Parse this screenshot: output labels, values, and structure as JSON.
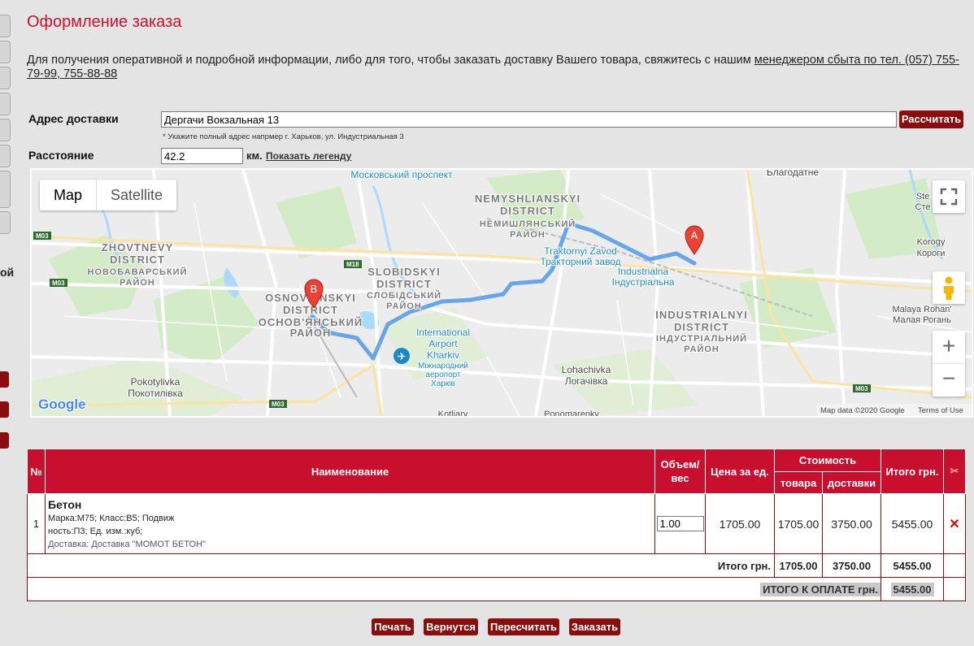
{
  "page": {
    "title": "Оформление заказа"
  },
  "info": {
    "text": "Для получения оперативной и подробной информации, либо для того, чтобы заказать доставку Вашего товара, свяжитесь с нашим ",
    "link": "менеджером сбыта по тел. (057) 755-79-99, 755-88-88"
  },
  "left_fragment": "ой",
  "delivery": {
    "label": "Адрес доставки",
    "value": "Дергачи Вокзальная 13",
    "calc_button": "Рассчитать",
    "hint": "* Укажите полный адрес напрмер г. Харьков, ул. Индустриальная 3"
  },
  "distance": {
    "label": "Расстояние",
    "value": "42.2",
    "unit": "км.",
    "legend_link": "Показать легенду"
  },
  "map": {
    "type_map": "Map",
    "type_satellite": "Satellite",
    "labels": {
      "moskovskyi": "Московський проспект",
      "blahodatne": "Благодатне",
      "nem_en": "NEMYSHLIANSKYI",
      "nem_en2": "DISTRICT",
      "nem_ua": "НЕМИШЛЯНСЬКИЙ",
      "nem_ua2": "РАЙОН",
      "zhov_en": "ZHOVTNEVY",
      "zhov_en2": "DISTRICT",
      "zhov_ua": "НОВОБАВАРСЬКИЙ",
      "zhov_ua2": "РАЙОН",
      "slob_en": "SLOBIDSKYI",
      "slob_en2": "DISTRICT",
      "slob_ua": "СЛОБІДСЬКИЙ",
      "slob_ua2": "РАЙОН",
      "osn_en": "OSNOVIANSKYI",
      "osn_en2": "DISTRICT",
      "osn_ua": "ОСНОВ'ЯНСЬКИЙ",
      "osn_ua2": "РАЙОН",
      "trak_en": "Traktornyi Zavod",
      "trak_ua": "Тракторний завод",
      "indus_en": "Industrialna",
      "indus_ua": "Індустріальна",
      "ind_en": "INDUSTRIALNYI",
      "ind_en2": "DISTRICT",
      "ind_ua": "ІНДУСТРІАЛЬНИЙ",
      "ind_ua2": "РАЙОН",
      "airport_en": "International",
      "airport_en2": "Airport",
      "airport_en3": "Kharkiv",
      "airport_ua": "Міжнародний",
      "airport_ua2": "аеропорт",
      "airport_ua3": "Харків",
      "loha_en": "Lohachivka",
      "loha_ua": "Логачівка",
      "poko_en": "Pokotylivka",
      "poko_ua": "Покотилівка",
      "korogy_en": "Korogy",
      "korogy_ua": "Короги",
      "malaya_en": "Malaya Rohan'",
      "malaya_ua": "Малая Рогань",
      "ste1": "Ste",
      "ste2": "Сте",
      "kotliary": "Kotliary",
      "ponomarenky": "Ponomarenky",
      "m03a": "M03",
      "m03b": "M03",
      "m03c": "M03",
      "m03d": "M03",
      "m18": "M18",
      "google": "Google",
      "mapdata": "Map data ©2020 Google",
      "terms": "Terms of Use",
      "marker_a": "A",
      "marker_b": "B"
    }
  },
  "table": {
    "headers": {
      "num": "№",
      "name": "Наименование",
      "volume": "Объем/вес",
      "price": "Цена за ед.",
      "cost": "Стоимость",
      "goods": "товара",
      "delivery": "доставки",
      "total": "Итого грн."
    },
    "row": {
      "num": "1",
      "name": "Бетон",
      "spec1": "Марка:M75; Класс:B5; Подвиж",
      "spec2": "ность:П3; Ед. изм.:куб;",
      "delivery_note": "Доставка: Доставка \"МОМОТ БЕТОН\"",
      "quantity": "1.00",
      "price": "1705.00",
      "goods": "1705.00",
      "delivery": "3750.00",
      "total": "5455.00"
    },
    "sum": {
      "label": "Итого грн.",
      "goods": "1705.00",
      "delivery": "3750.00",
      "total": "5455.00"
    },
    "pay": {
      "label": "ИТОГО К ОПЛАТЕ грн.",
      "total": "5455.00"
    }
  },
  "buttons": {
    "print": "Печать",
    "back": "Вернутся",
    "recalc": "Пересчитать",
    "order": "Заказать"
  },
  "colors": {
    "accent": "#c8102e",
    "button": "#8b0e0e",
    "route": "#5a9ee8"
  }
}
